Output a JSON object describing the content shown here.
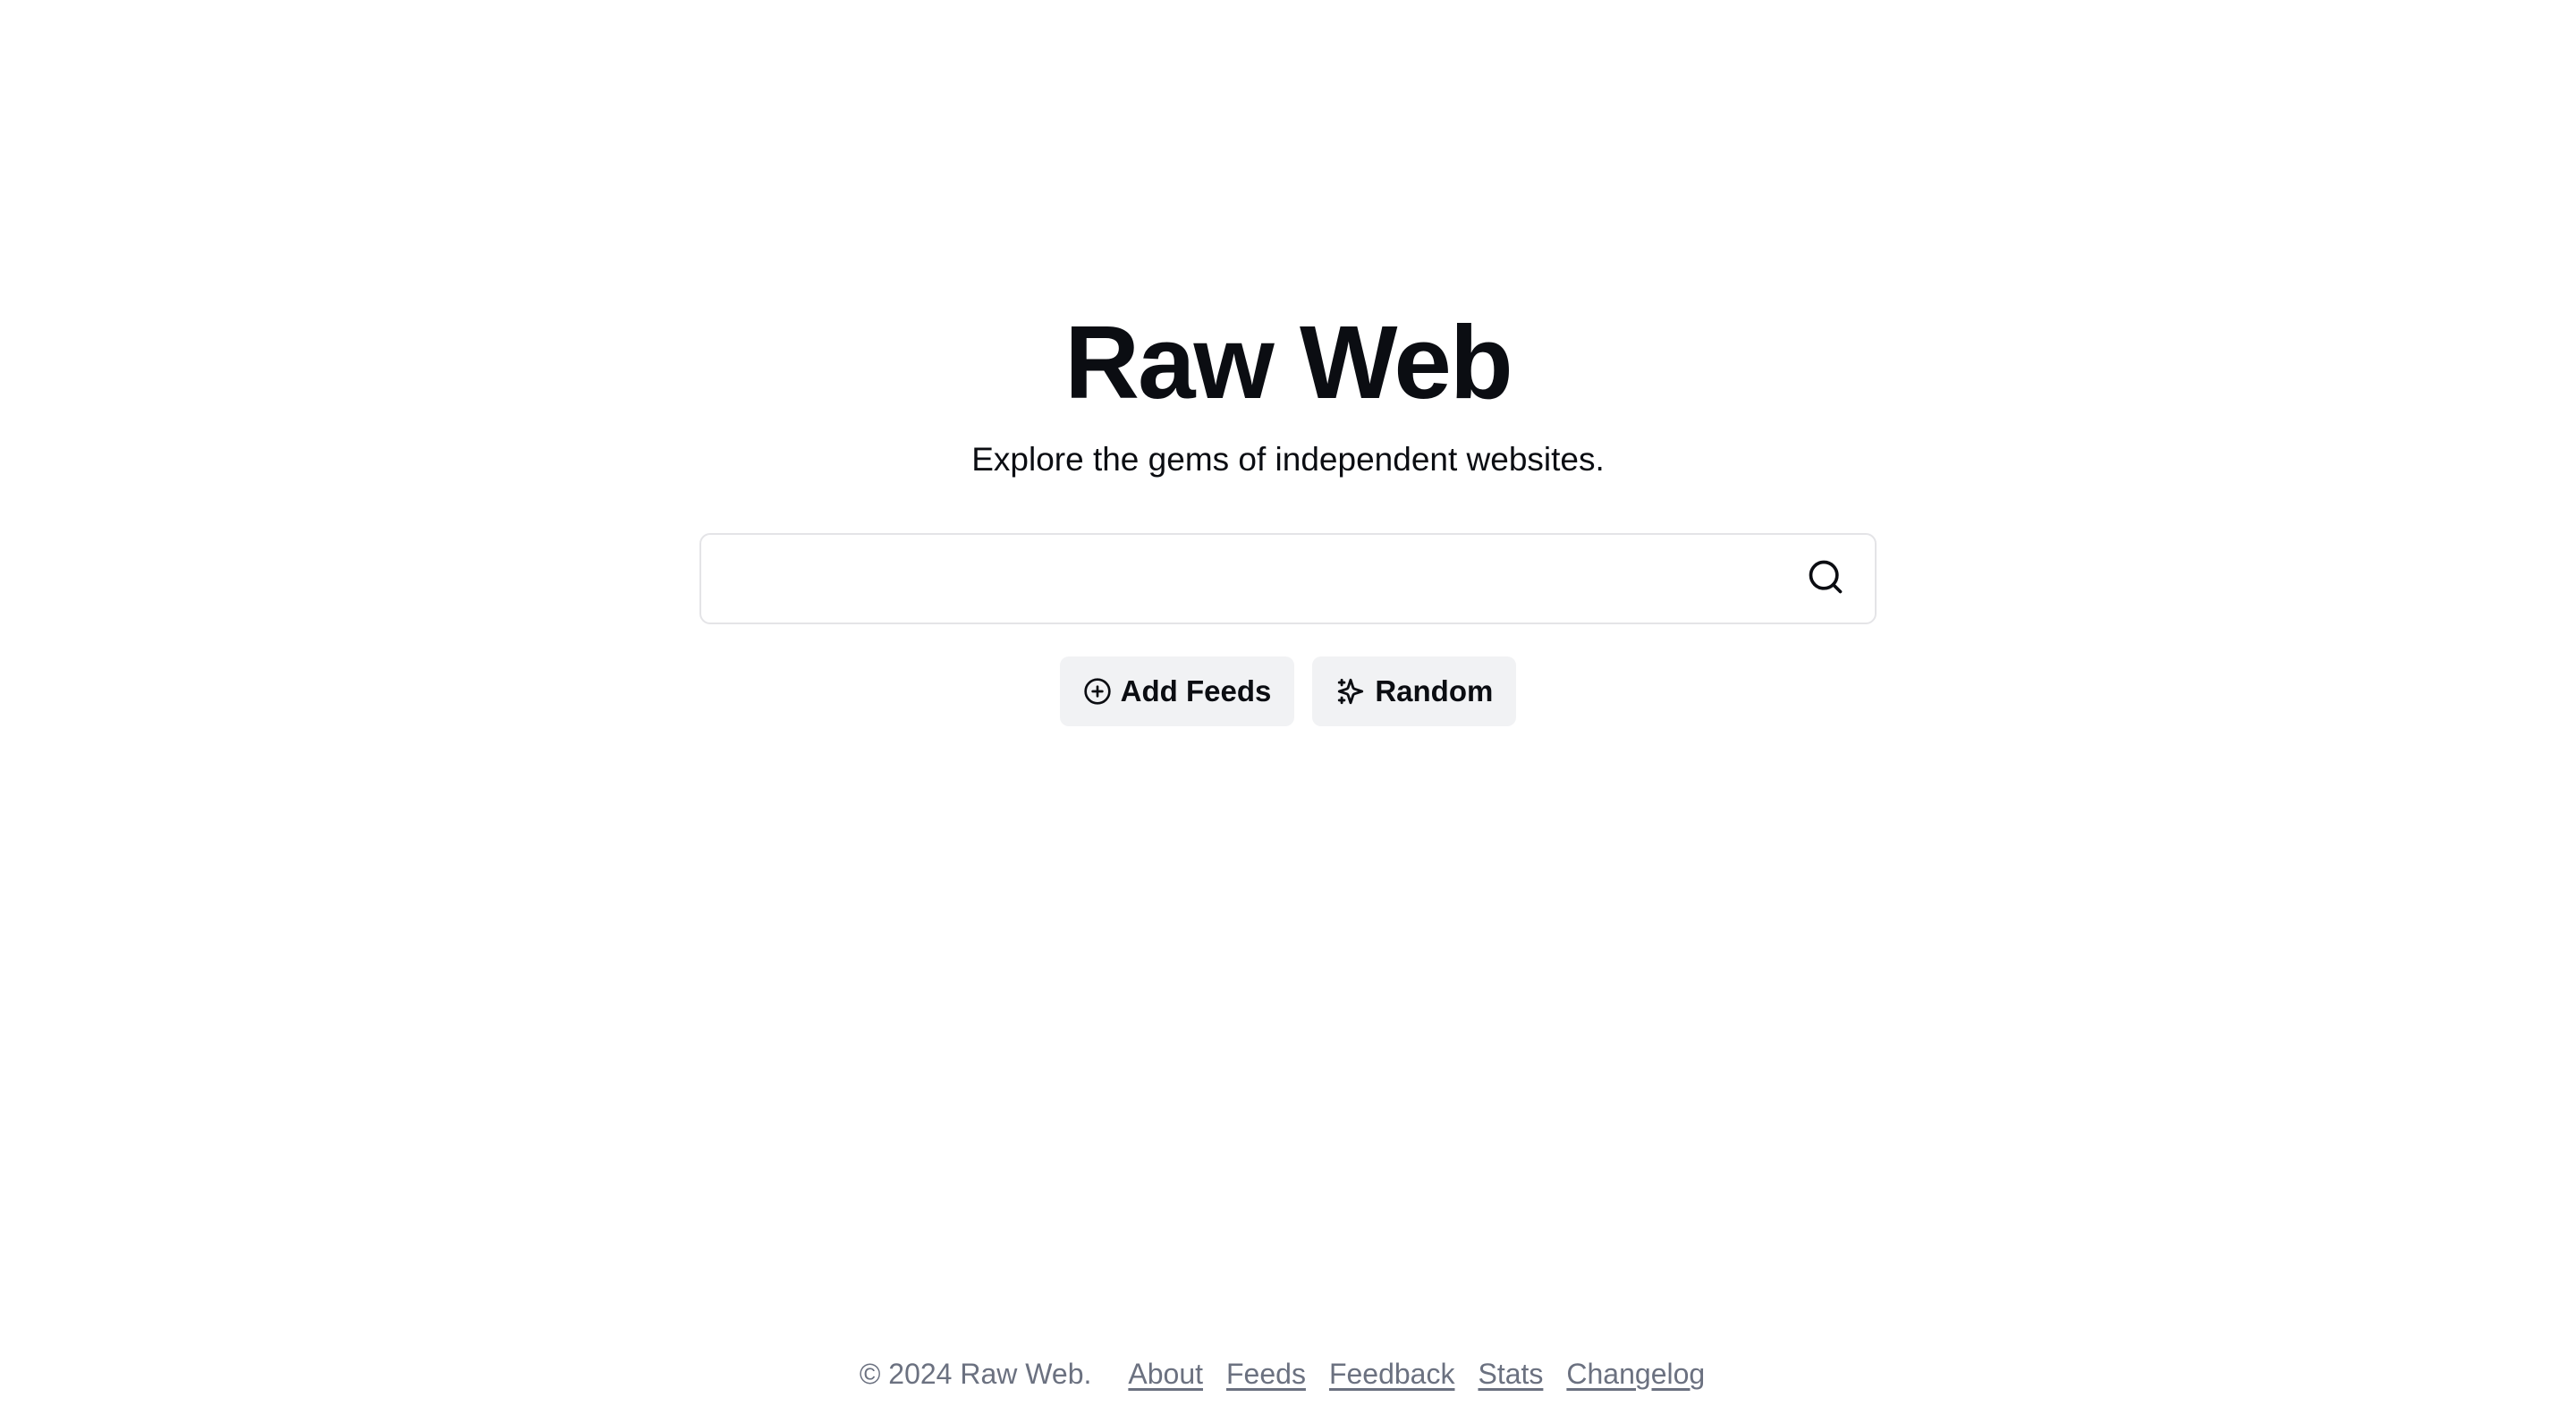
{
  "hero": {
    "title": "Raw Web",
    "subtitle": "Explore the gems of independent websites."
  },
  "search": {
    "value": "",
    "placeholder": "",
    "icon": "search-icon"
  },
  "actions": {
    "add_feeds": {
      "label": "Add Feeds",
      "icon": "plus-circle-icon"
    },
    "random": {
      "label": "Random",
      "icon": "sparkles-icon"
    }
  },
  "footer": {
    "copyright": "© 2024 Raw Web.",
    "links": {
      "about": "About",
      "feeds": "Feeds",
      "feedback": "Feedback",
      "stats": "Stats",
      "changelog": "Changelog"
    }
  },
  "colors": {
    "text": "#0b0d12",
    "muted": "#6b7180",
    "button_bg": "#f1f2f4",
    "border": "#e4e4e7",
    "background": "#ffffff"
  }
}
